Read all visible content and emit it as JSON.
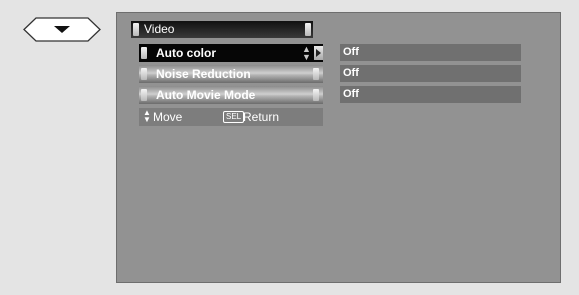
{
  "menu": {
    "title": "Video",
    "items": [
      {
        "label": "Auto color",
        "value": "Off",
        "selected": true
      },
      {
        "label": "Noise Reduction",
        "value": "Off",
        "selected": false
      },
      {
        "label": "Auto Movie Mode",
        "value": "Off",
        "selected": false
      }
    ]
  },
  "help": {
    "move_label": "Move",
    "sel_key": "SEL",
    "return_label": "Return"
  },
  "icons": {
    "nav": "down-arrow-icon",
    "move": "up-down-arrows-icon",
    "item_adjust": "up-down-arrows-icon",
    "item_enter": "right-arrow-icon"
  },
  "colors": {
    "page_background": "#e4e4e4",
    "screen_background": "#929292",
    "selected_item": "#060606",
    "value_box": "#707070",
    "text": "#ffffff"
  }
}
